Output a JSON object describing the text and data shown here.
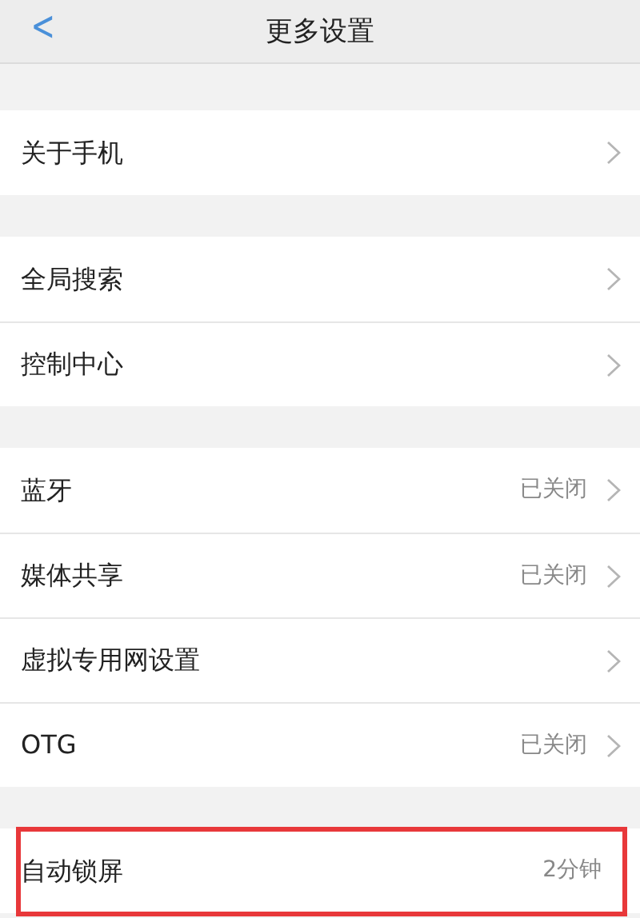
{
  "header": {
    "back": "<",
    "title": "更多设置"
  },
  "groups": [
    {
      "items": [
        {
          "label": "关于手机",
          "chevron": true,
          "highlighted": false
        }
      ]
    },
    {
      "items": [
        {
          "label": "全局搜索",
          "chevron": true,
          "highlighted": false
        },
        {
          "label": "控制中心",
          "chevron": true,
          "highlighted": false
        }
      ]
    },
    {
      "items": [
        {
          "label": "蓝牙",
          "value": "已关闭",
          "chevron": true,
          "highlighted": false
        },
        {
          "label": "媒体共享",
          "value": "已关闭",
          "chevron": true,
          "highlighted": false
        },
        {
          "label": "虚拟专用网设置",
          "chevron": true,
          "highlighted": false
        },
        {
          "label": "OTG",
          "value": "已关闭",
          "chevron": true,
          "highlighted": false
        }
      ]
    },
    {
      "items": [
        {
          "label": "自动锁屏",
          "value": "2分钟",
          "chevron": false,
          "highlighted": true
        }
      ]
    }
  ]
}
